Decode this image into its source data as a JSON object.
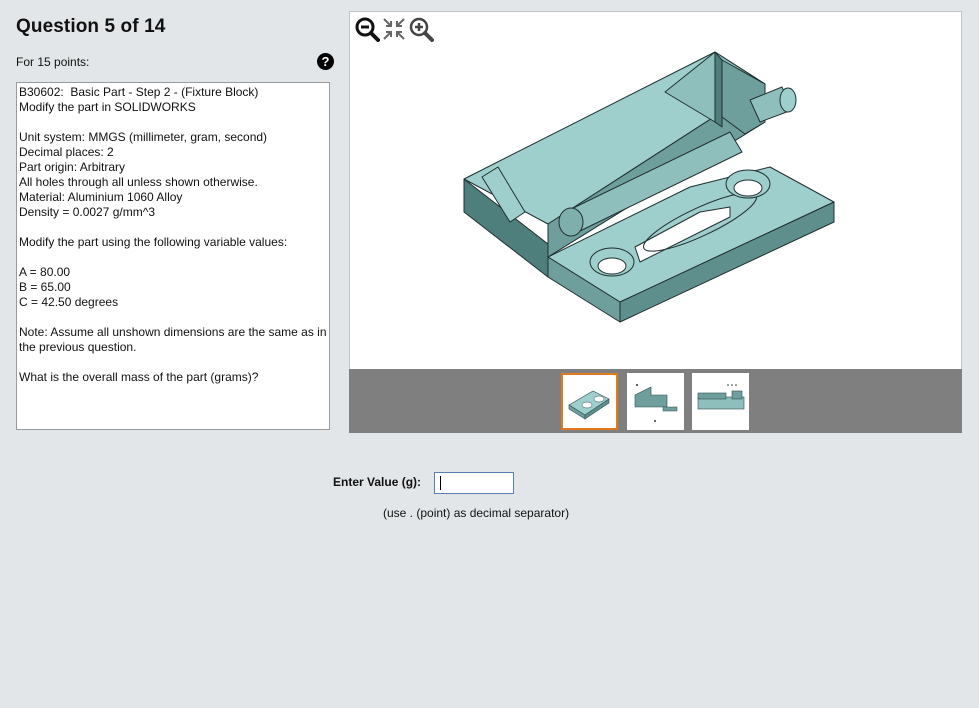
{
  "question": {
    "title": "Question 5 of 14",
    "points": "For 15 points:",
    "help_glyph": "?"
  },
  "description": {
    "lines": [
      "B30602:  Basic Part - Step 2 - (Fixture Block)",
      "Modify the part in SOLIDWORKS",
      "",
      "Unit system: MMGS (millimeter, gram, second)",
      "Decimal places: 2",
      "Part origin: Arbitrary",
      "All holes through all unless shown otherwise.",
      "Material: Aluminium 1060 Alloy",
      "Density = 0.0027 g/mm^3",
      "",
      "Modify the part using the following variable values:",
      "",
      "A = 80.00",
      "B = 65.00",
      "C = 42.50 degrees",
      "",
      "Note: Assume all unshown dimensions are the same as in",
      "the previous question.",
      "",
      "What is the overall mass of the part (grams)?"
    ]
  },
  "viewer": {
    "tools": [
      "zoom-out-icon",
      "fit-view-icon",
      "zoom-in-icon"
    ],
    "thumbnails": [
      {
        "name": "isometric-view",
        "selected": true
      },
      {
        "name": "side-view",
        "selected": false
      },
      {
        "name": "front-view",
        "selected": false
      }
    ],
    "colors": {
      "part_face_top": "#9fcfcd",
      "part_face_side": "#6f9f9d",
      "part_face_dark": "#4f7f7d",
      "part_edge": "#1f2f2f",
      "strip": "#7f7f7f",
      "selected_border": "#e07a1a"
    }
  },
  "answer": {
    "label": "Enter Value (g):",
    "value": "",
    "hint": "(use . (point) as decimal separator)"
  }
}
